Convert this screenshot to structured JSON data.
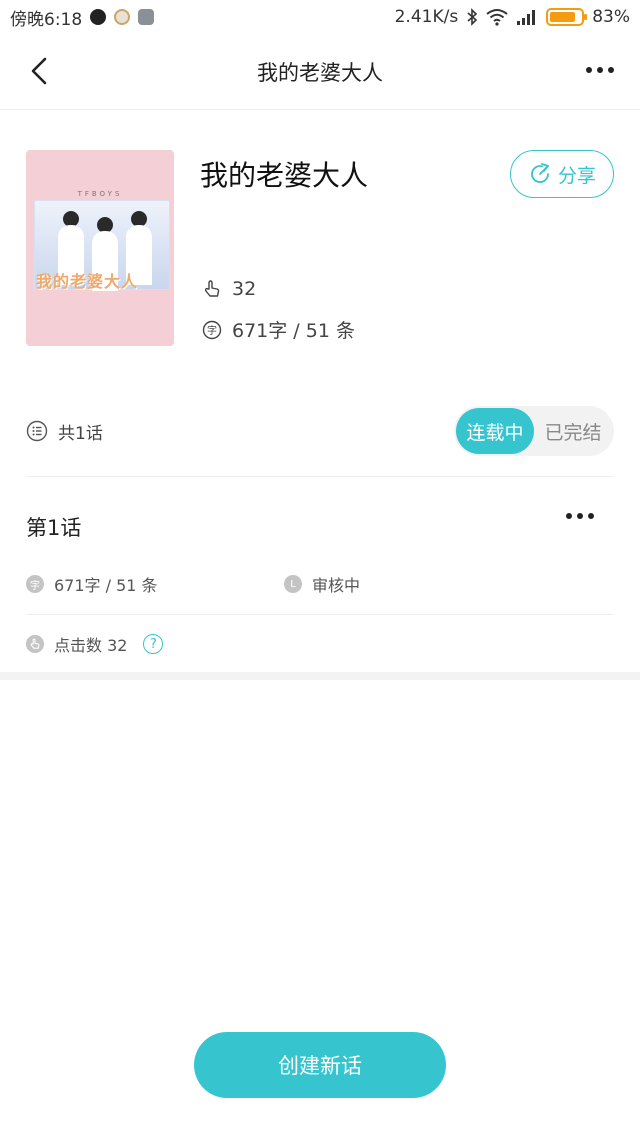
{
  "status_bar": {
    "time": "傍晚6:18",
    "speed": "2.41K/s",
    "battery": "83%",
    "battery_level": 0.83
  },
  "header": {
    "title": "我的老婆大人",
    "back_icon": "chevron-left-icon",
    "more_icon": "more-horizontal-icon"
  },
  "book": {
    "title": "我的老婆大人",
    "cover_text": "我的老婆大人",
    "cover_band": "TFBOYS",
    "share_label": "分享",
    "likes": "32",
    "word_stats": "671字 / 51 条"
  },
  "episodes": {
    "count_label": "共1话",
    "status_on": "连载中",
    "status_off": "已完结"
  },
  "chapter": {
    "title": "第1话",
    "word_icon_text": "字",
    "word_stats": "671字 / 51 条",
    "review_icon_text": "L",
    "review_status": "审核中",
    "clicks": "点击数 32",
    "help_symbol": "?"
  },
  "actions": {
    "create_label": "创建新话"
  },
  "colors": {
    "accent": "#36c4cf",
    "battery": "#f39c12",
    "cover_bg": "#f5cfd6"
  }
}
